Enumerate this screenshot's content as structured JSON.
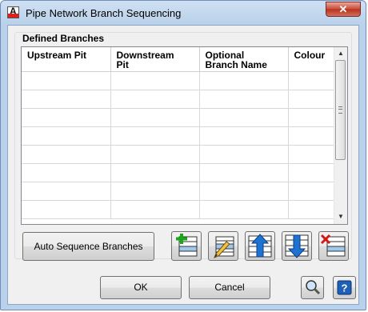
{
  "window": {
    "title": "Pipe Network Branch Sequencing",
    "close_glyph": "✕"
  },
  "group": {
    "label": "Defined Branches"
  },
  "table": {
    "columns": [
      {
        "line1": "Upstream Pit",
        "line2": ""
      },
      {
        "line1": "Downstream",
        "line2": "Pit"
      },
      {
        "line1": "Optional",
        "line2": "Branch Name"
      },
      {
        "line1": "Colour",
        "line2": ""
      }
    ],
    "visible_empty_rows": 8
  },
  "buttons": {
    "auto_sequence": "Auto Sequence Branches",
    "ok": "OK",
    "cancel": "Cancel"
  },
  "icons": {
    "add": "add-branch-icon",
    "edit": "edit-branch-icon",
    "move_up": "move-up-icon",
    "move_down": "move-down-icon",
    "delete": "delete-branch-icon",
    "zoom": "zoom-icon",
    "help": "help-icon"
  },
  "colors": {
    "accent_blue": "#1e73d2",
    "delete_red": "#d01818",
    "add_green": "#1aa81a",
    "title_bar": "#b9d1ea"
  }
}
